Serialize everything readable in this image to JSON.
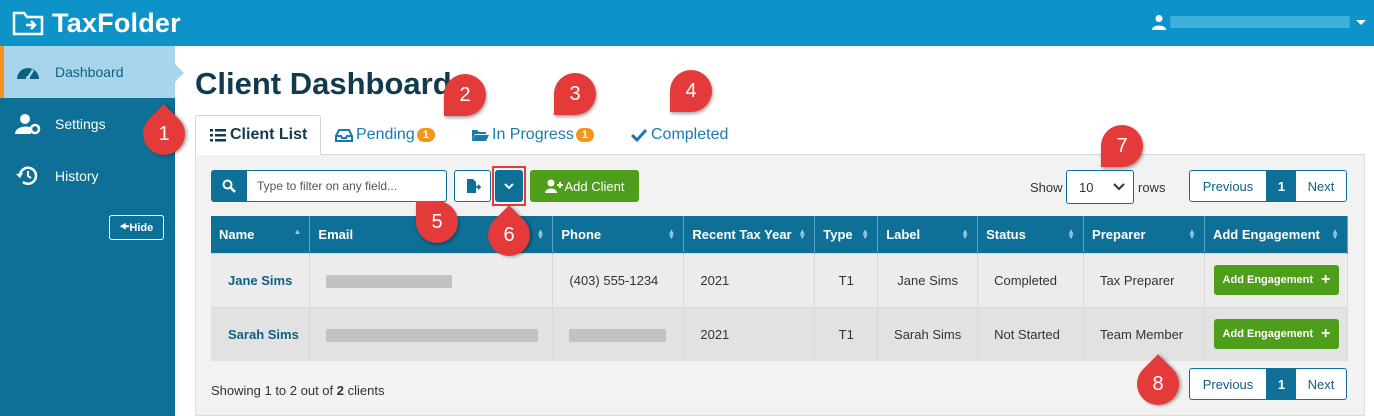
{
  "app": {
    "logo_text": "TaxFolder",
    "brand_color": "#0e93c9",
    "sidebar_color": "#0e6f97",
    "accent_color": "#f7941d"
  },
  "sidebar": {
    "items": [
      {
        "label": "Dashboard",
        "icon": "dashboard-gauge-icon",
        "active": true
      },
      {
        "label": "Settings",
        "icon": "user-gear-icon",
        "active": false
      },
      {
        "label": "History",
        "icon": "history-icon",
        "active": false
      }
    ],
    "hide_label": "Hide"
  },
  "main": {
    "title": "Client Dashboard",
    "tabs": [
      {
        "label": "Client List",
        "icon": "list-icon",
        "active": true
      },
      {
        "label": "Pending",
        "icon": "inbox-icon",
        "badge": "1"
      },
      {
        "label": "In Progress",
        "icon": "folder-open-icon",
        "badge": "1"
      },
      {
        "label": "Completed",
        "icon": "check-icon"
      }
    ]
  },
  "toolbar": {
    "search_placeholder": "Type to filter on any field...",
    "add_client_label": "Add Client",
    "show_label": "Show",
    "rows_value": "10",
    "rows_label": "rows"
  },
  "pager": {
    "previous": "Previous",
    "current": "1",
    "next": "Next"
  },
  "table": {
    "columns": [
      "Name",
      "Email",
      "Phone",
      "Recent Tax Year",
      "Type",
      "Label",
      "Status",
      "Preparer",
      "Add Engagement"
    ],
    "rows": [
      {
        "name": "Jane Sims",
        "phone": "(403) 555-1234",
        "year": "2021",
        "type": "T1",
        "label": "Jane Sims",
        "status": "Completed",
        "preparer": "Tax Preparer",
        "action": "Add Engagement"
      },
      {
        "name": "Sarah Sims",
        "phone": "",
        "year": "2021",
        "type": "T1",
        "label": "Sarah Sims",
        "status": "Not Started",
        "preparer": "Team Member",
        "action": "Add Engagement"
      }
    ]
  },
  "footer": {
    "showing_prefix": "Showing 1 to 2 out of ",
    "showing_count": "2",
    "showing_suffix": " clients"
  },
  "callouts": [
    "1",
    "2",
    "3",
    "4",
    "5",
    "6",
    "7",
    "8"
  ]
}
